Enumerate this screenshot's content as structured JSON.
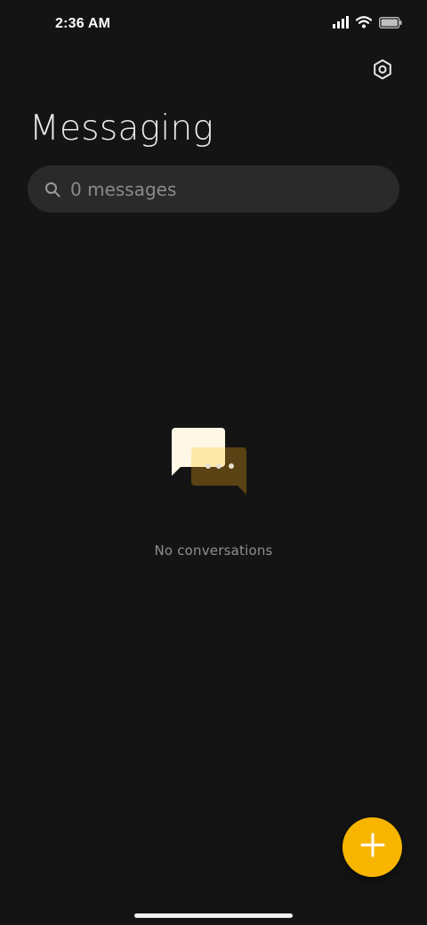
{
  "status_bar": {
    "time": "2:36 AM",
    "icons": [
      "signal-icon",
      "wifi-icon",
      "battery-icon"
    ]
  },
  "header": {
    "title": "Messaging",
    "settings_icon": "gear-icon"
  },
  "search": {
    "placeholder": "0 messages",
    "icon": "search-icon"
  },
  "empty_state": {
    "icon": "chat-bubbles-icon",
    "text": "No conversations"
  },
  "fab": {
    "icon": "plus-icon"
  },
  "colors": {
    "background": "#141414",
    "search_bg": "#2a2a2a",
    "accent": "#f7b500",
    "bubble_light": "#fff8e6",
    "bubble_dark": "#5a4214"
  }
}
